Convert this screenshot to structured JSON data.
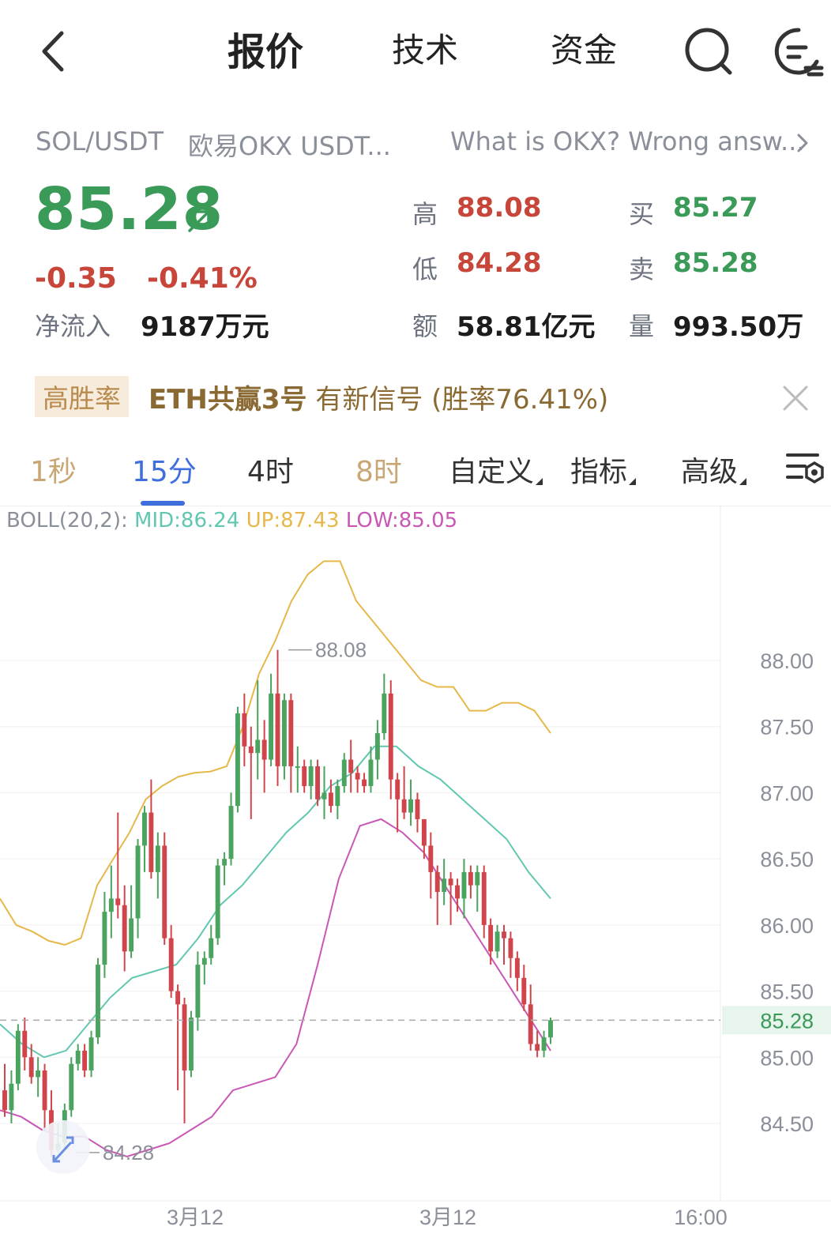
{
  "header": {
    "tabs": [
      "报价",
      "技术",
      "资金"
    ]
  },
  "pair": {
    "symbol": "SOL/USDT",
    "exchange": "欧易OKX USDT...",
    "ad_text": "What is OKX? Wrong answ..."
  },
  "quote": {
    "last": "85.28",
    "change": "-0.35",
    "change_pct": "-0.41%",
    "net_inflow_label": "净流入",
    "net_inflow": "9187万元",
    "high_label": "高",
    "high": "88.08",
    "low_label": "低",
    "low": "84.28",
    "amount_label": "额",
    "amount": "58.81亿元",
    "bid_label": "买",
    "bid": "85.27",
    "ask_label": "卖",
    "ask": "85.28",
    "volume_label": "量",
    "volume": "993.50万"
  },
  "signal": {
    "tag": "高胜率",
    "name": "ETH共赢3号",
    "text": "有新信号 (胜率76.41%)"
  },
  "intervals": {
    "items": [
      "1秒",
      "15分",
      "4时",
      "8时",
      "自定义",
      "指标",
      "高级"
    ],
    "selected": "15分"
  },
  "indicator": {
    "prefix": "BOLL(20,2): ",
    "mid": "MID:86.24",
    "up": "UP:87.43",
    "low": "LOW:85.05"
  },
  "colors": {
    "up_candle": "#4aa35e",
    "down_candle": "#d0454c",
    "boll_mid": "#62c7b1",
    "boll_up": "#e6b84a",
    "boll_low": "#c957b6",
    "accent": "#3f6fdc"
  },
  "chart_data": {
    "type": "candlestick",
    "y_ticks": [
      "88.00",
      "87.50",
      "87.00",
      "86.50",
      "86.00",
      "85.50",
      "85.00",
      "84.50"
    ],
    "ylim": [
      84.2,
      88.8
    ],
    "x_ticks": [
      "3月12",
      "3月12",
      "16:00"
    ],
    "current_price": "85.28",
    "high_marker": "88.08",
    "low_marker": "84.28",
    "candles": [
      [
        84.75,
        84.6,
        84.55,
        84.95
      ],
      [
        84.6,
        84.8,
        84.5,
        84.9
      ],
      [
        84.8,
        85.2,
        84.75,
        85.25
      ],
      [
        85.2,
        85.0,
        84.9,
        85.3
      ],
      [
        85.0,
        84.85,
        84.8,
        85.1
      ],
      [
        84.85,
        84.9,
        84.7,
        85.0
      ],
      [
        84.9,
        84.6,
        84.45,
        84.95
      ],
      [
        84.6,
        84.3,
        84.25,
        84.75
      ],
      [
        84.3,
        84.35,
        84.28,
        84.5
      ],
      [
        84.35,
        84.6,
        84.3,
        84.65
      ],
      [
        84.6,
        84.95,
        84.55,
        85.0
      ],
      [
        84.95,
        85.05,
        84.9,
        85.1
      ],
      [
        85.05,
        84.9,
        84.85,
        85.1
      ],
      [
        84.9,
        85.15,
        84.85,
        85.2
      ],
      [
        85.15,
        85.7,
        85.1,
        85.75
      ],
      [
        85.7,
        86.1,
        85.6,
        86.25
      ],
      [
        86.1,
        86.2,
        85.9,
        86.45
      ],
      [
        86.2,
        86.15,
        86.05,
        86.85
      ],
      [
        86.15,
        85.8,
        85.65,
        86.3
      ],
      [
        85.8,
        86.05,
        85.75,
        86.3
      ],
      [
        86.05,
        86.6,
        85.9,
        86.65
      ],
      [
        86.6,
        86.85,
        86.4,
        86.9
      ],
      [
        86.85,
        86.4,
        86.35,
        87.1
      ],
      [
        86.4,
        86.6,
        86.2,
        86.7
      ],
      [
        86.6,
        85.9,
        85.85,
        86.7
      ],
      [
        85.9,
        85.5,
        85.45,
        86.0
      ],
      [
        85.5,
        85.4,
        84.75,
        85.55
      ],
      [
        85.4,
        84.9,
        84.5,
        85.45
      ],
      [
        84.9,
        85.3,
        84.85,
        85.35
      ],
      [
        85.3,
        85.7,
        85.2,
        85.8
      ],
      [
        85.7,
        85.75,
        85.55,
        85.8
      ],
      [
        85.75,
        85.9,
        85.7,
        86.0
      ],
      [
        85.9,
        86.45,
        85.85,
        86.5
      ],
      [
        86.45,
        86.5,
        86.3,
        86.55
      ],
      [
        86.5,
        86.9,
        86.45,
        87.0
      ],
      [
        86.9,
        87.6,
        86.85,
        87.65
      ],
      [
        87.6,
        87.35,
        87.2,
        87.75
      ],
      [
        87.35,
        87.3,
        86.8,
        87.5
      ],
      [
        87.3,
        87.4,
        87.1,
        87.85
      ],
      [
        87.4,
        87.25,
        87.0,
        87.55
      ],
      [
        87.25,
        87.75,
        87.2,
        87.9
      ],
      [
        87.75,
        87.2,
        87.05,
        88.08
      ],
      [
        87.2,
        87.7,
        87.1,
        87.75
      ],
      [
        87.7,
        87.2,
        87.0,
        87.75
      ],
      [
        87.2,
        87.2,
        87.0,
        87.35
      ],
      [
        87.2,
        87.05,
        87.0,
        87.25
      ],
      [
        87.05,
        87.2,
        86.95,
        87.25
      ],
      [
        87.2,
        86.95,
        86.9,
        87.25
      ],
      [
        86.95,
        87.0,
        86.8,
        87.2
      ],
      [
        87.0,
        86.9,
        86.85,
        87.1
      ],
      [
        86.9,
        87.05,
        86.8,
        87.1
      ],
      [
        87.05,
        87.25,
        87.0,
        87.3
      ],
      [
        87.25,
        87.15,
        87.0,
        87.4
      ],
      [
        87.15,
        87.1,
        87.0,
        87.2
      ],
      [
        87.1,
        87.05,
        87.0,
        87.15
      ],
      [
        87.05,
        87.25,
        87.0,
        87.35
      ],
      [
        87.25,
        87.45,
        87.1,
        87.55
      ],
      [
        87.45,
        87.75,
        87.4,
        87.9
      ],
      [
        87.75,
        87.1,
        86.95,
        87.85
      ],
      [
        87.1,
        86.95,
        86.7,
        87.15
      ],
      [
        86.95,
        86.85,
        86.8,
        87.2
      ],
      [
        86.85,
        86.95,
        86.75,
        87.1
      ],
      [
        86.95,
        86.8,
        86.7,
        87.0
      ],
      [
        86.8,
        86.6,
        86.5,
        86.8
      ],
      [
        86.6,
        86.4,
        86.2,
        86.7
      ],
      [
        86.4,
        86.25,
        86.0,
        86.45
      ],
      [
        86.25,
        86.35,
        86.15,
        86.5
      ],
      [
        86.35,
        86.3,
        86.0,
        86.4
      ],
      [
        86.3,
        86.2,
        86.1,
        86.35
      ],
      [
        86.2,
        86.4,
        86.05,
        86.5
      ],
      [
        86.4,
        86.3,
        86.2,
        86.45
      ],
      [
        86.3,
        86.4,
        86.1,
        86.45
      ],
      [
        86.4,
        86.0,
        85.9,
        86.45
      ],
      [
        86.0,
        85.8,
        85.7,
        86.05
      ],
      [
        85.8,
        85.95,
        85.75,
        86.0
      ],
      [
        85.95,
        85.9,
        85.7,
        86.0
      ],
      [
        85.9,
        85.75,
        85.6,
        85.95
      ],
      [
        85.75,
        85.6,
        85.5,
        85.8
      ],
      [
        85.6,
        85.4,
        85.35,
        85.7
      ],
      [
        85.4,
        85.1,
        85.05,
        85.55
      ],
      [
        85.1,
        85.05,
        85.0,
        85.2
      ],
      [
        85.05,
        85.15,
        85.0,
        85.2
      ],
      [
        85.15,
        85.28,
        85.1,
        85.3
      ]
    ],
    "boll_up": [
      86.2,
      86.0,
      85.95,
      85.88,
      85.85,
      85.9,
      86.3,
      86.5,
      86.7,
      86.95,
      87.05,
      87.12,
      87.15,
      87.16,
      87.2,
      87.5,
      87.9,
      88.15,
      88.45,
      88.65,
      88.75,
      88.75,
      88.45,
      88.3,
      88.15,
      88.0,
      87.85,
      87.8,
      87.8,
      87.62,
      87.62,
      87.68,
      87.68,
      87.62,
      87.45
    ],
    "boll_mid": [
      85.25,
      85.1,
      85.0,
      85.05,
      85.25,
      85.45,
      85.6,
      85.65,
      85.7,
      85.9,
      86.15,
      86.3,
      86.5,
      86.7,
      86.85,
      87.05,
      87.15,
      87.35,
      87.35,
      87.2,
      87.1,
      86.95,
      86.8,
      86.65,
      86.4,
      86.2
    ],
    "boll_low": [
      84.6,
      84.55,
      84.45,
      84.4,
      84.4,
      84.3,
      84.25,
      84.3,
      84.35,
      84.45,
      84.55,
      84.75,
      84.8,
      84.85,
      85.1,
      85.7,
      86.35,
      86.75,
      86.8,
      86.7,
      86.55,
      86.3,
      86.05,
      85.8,
      85.55,
      85.3,
      85.05
    ]
  }
}
